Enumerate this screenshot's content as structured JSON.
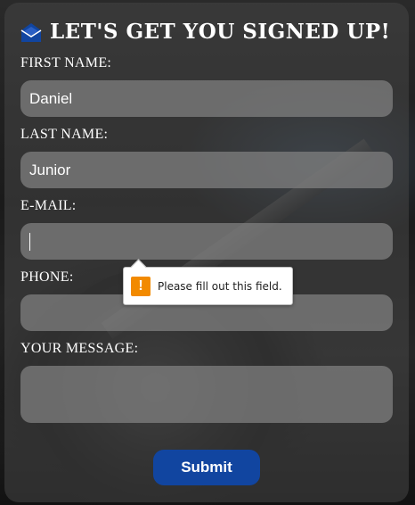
{
  "form": {
    "title": "LET'S GET YOU SIGNED UP!",
    "title_icon": "open-envelope-icon",
    "first_name": {
      "label": "FIRST NAME:",
      "value": "Daniel"
    },
    "last_name": {
      "label": "LAST NAME:",
      "value": "Junior"
    },
    "email": {
      "label": "E-MAIL:",
      "value": ""
    },
    "phone": {
      "label": "PHONE:",
      "value": ""
    },
    "message": {
      "label": "YOUR MESSAGE:",
      "value": ""
    },
    "submit_label": "Submit"
  },
  "validation_tooltip": {
    "text": "Please fill out this field.",
    "icon": "warning-icon",
    "icon_glyph": "!",
    "icon_color": "#f28a00"
  },
  "colors": {
    "accent": "#1145a0",
    "field_bg": "rgba(130,130,130,0.72)"
  }
}
